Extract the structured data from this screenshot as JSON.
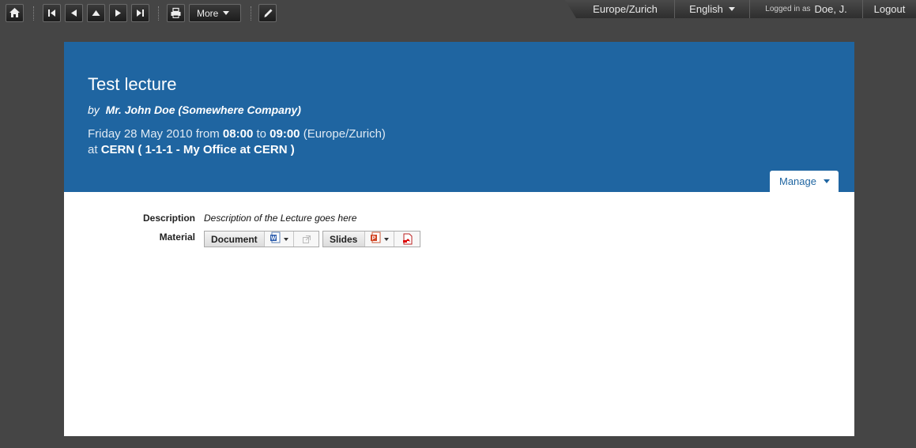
{
  "toolbar": {
    "home_icon": "home-icon",
    "first_icon": "first-page-icon",
    "prev_icon": "previous-icon",
    "up_icon": "up-icon",
    "next_icon": "next-icon",
    "last_icon": "last-page-icon",
    "print_icon": "printer-icon",
    "more_label": "More",
    "edit_icon": "pencil-icon"
  },
  "session": {
    "timezone": "Europe/Zurich",
    "language": "English",
    "logged_in_label": "Logged in as",
    "user": "Doe, J.",
    "logout": "Logout"
  },
  "event": {
    "title": "Test lecture",
    "by_label": "by",
    "speaker": "Mr. John Doe (Somewhere Company)",
    "date": "Friday 28 May 2010",
    "from_label": "from",
    "start": "08:00",
    "to_label": "to",
    "end": "09:00",
    "tz": "(Europe/Zurich)",
    "at_label": "at",
    "location": "CERN ( 1-1-1 - My Office at CERN )",
    "manage": "Manage"
  },
  "details": {
    "description_label": "Description",
    "description": "Description of the Lecture goes here",
    "material_label": "Material",
    "materials": [
      {
        "name": "Document",
        "icons": [
          "word-file-icon",
          "external-link-icon"
        ]
      },
      {
        "name": "Slides",
        "icons": [
          "powerpoint-file-icon",
          "pdf-file-icon"
        ]
      }
    ]
  },
  "colors": {
    "header_bg": "#1f65a1",
    "page_bg": "#454545"
  }
}
